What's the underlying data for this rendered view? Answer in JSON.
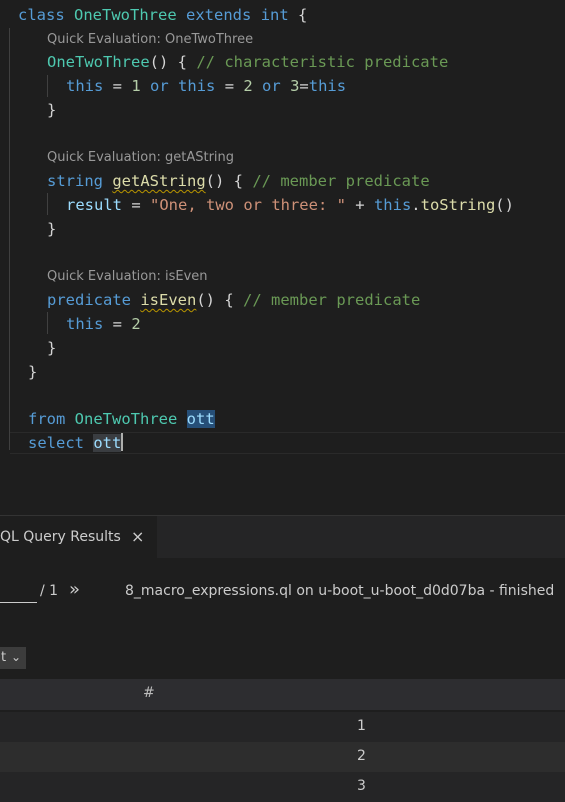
{
  "editor": {
    "lens": {
      "class": "Quick Evaluation: OneTwoThree",
      "getAString": "Quick Evaluation: getAString",
      "isEven": "Quick Evaluation: isEven"
    },
    "l1": {
      "a": "class",
      "b": "OneTwoThree",
      "c": "extends",
      "d": "int",
      "e": "{"
    },
    "l2": {
      "a": "OneTwoThree",
      "b": "() { ",
      "c": "// characteristic predicate"
    },
    "l3": {
      "a": "this",
      "b": " = ",
      "c": "1",
      "d": "or",
      "e": "this",
      "f": " = ",
      "g": "2",
      "h": "or",
      "i": "3",
      "j": "=",
      "k": "this"
    },
    "l4": "}",
    "l5": {
      "a": "string",
      "b": "getAString",
      "c": "() { ",
      "d": "// member predicate"
    },
    "l6": {
      "a": "result",
      "b": " = ",
      "c": "\"One, two or three: \"",
      "d": " + ",
      "e": "this",
      "f": ".",
      "g": "toString",
      "h": "()"
    },
    "l7": "}",
    "l8": {
      "a": "predicate",
      "b": "isEven",
      "c": "() { ",
      "d": "// member predicate"
    },
    "l9": {
      "a": "this",
      "b": " = ",
      "c": "2"
    },
    "l10": "}",
    "l11": "}",
    "l12": {
      "a": "from",
      "b": "OneTwoThree",
      "c": "ott"
    },
    "l13": {
      "a": "select",
      "b": "ott"
    }
  },
  "panel": {
    "tab_label": "QL Query Results",
    "close_icon": "×",
    "page_value": "",
    "page_total": "/ 1",
    "next_icon": "»",
    "status": "8_macro_expressions.ql on u-boot_u-boot_d0d07ba - finished",
    "result_set_visible": "t",
    "chevron_icon": "⌄",
    "columns": [
      "#"
    ],
    "rows": [
      "1",
      "2",
      "3"
    ]
  }
}
